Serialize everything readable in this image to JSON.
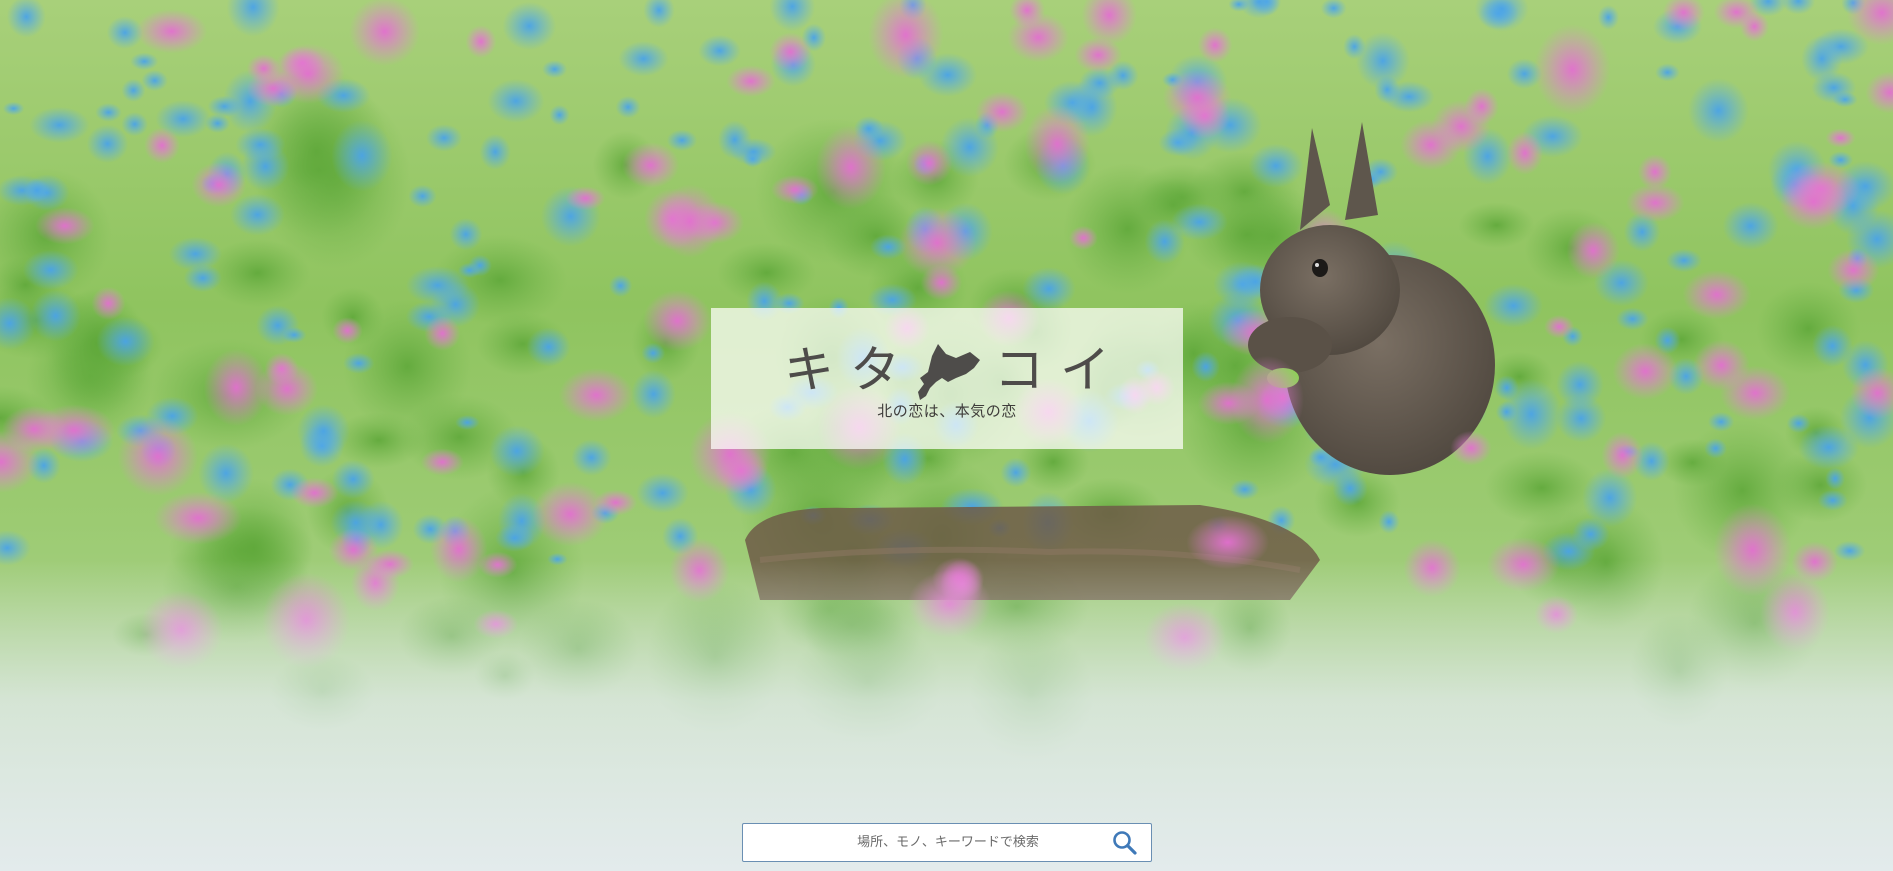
{
  "logo": {
    "char_ki": "キ",
    "char_ta": "タ",
    "char_ko": "コ",
    "char_i": "イ",
    "tagline": "北の恋は、本気の恋",
    "map_icon": "hokkaido-map-icon",
    "text_color": "#4e4c4a"
  },
  "search": {
    "placeholder": "場所、モノ、キーワードで検索",
    "value": "",
    "button_icon": "search-icon",
    "border_color": "#6a8fb3",
    "icon_color": "#3f79b8"
  },
  "background": {
    "subject": "squirrel among flowers",
    "fade_color": "#e3ebec"
  }
}
